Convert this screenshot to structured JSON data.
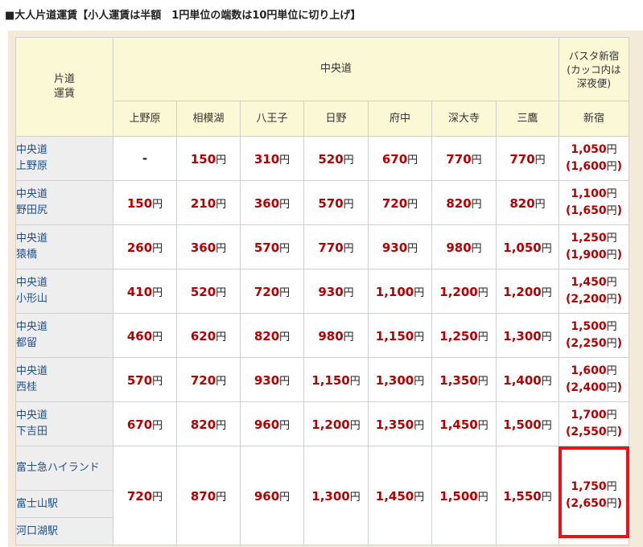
{
  "caption": "■大人片道運賃【小人運賃は半額　1円単位の端数は10円単位に切り上げ】",
  "header": {
    "corner": "片道\n運賃",
    "group": "中央道",
    "right_title": "バスタ新宿\n(カッコ内は\n深夜便)",
    "columns": [
      "上野原",
      "相模湖",
      "八王子",
      "日野",
      "府中",
      "深大寺",
      "三鷹"
    ],
    "right_column": "新宿"
  },
  "yen": "円",
  "rows": [
    {
      "label": "中央道\n上野原",
      "fares": [
        "-",
        "150",
        "310",
        "520",
        "670",
        "770",
        "770"
      ],
      "shinjuku": "1,050",
      "night": "1,600"
    },
    {
      "label": "中央道\n野田尻",
      "fares": [
        "150",
        "210",
        "360",
        "570",
        "720",
        "820",
        "820"
      ],
      "shinjuku": "1,100",
      "night": "1,650"
    },
    {
      "label": "中央道\n猿橋",
      "fares": [
        "260",
        "360",
        "570",
        "770",
        "930",
        "980",
        "1,050"
      ],
      "shinjuku": "1,250",
      "night": "1,900"
    },
    {
      "label": "中央道\n小形山",
      "fares": [
        "410",
        "520",
        "720",
        "930",
        "1,100",
        "1,200",
        "1,200"
      ],
      "shinjuku": "1,450",
      "night": "2,200"
    },
    {
      "label": "中央道\n都留",
      "fares": [
        "460",
        "620",
        "820",
        "980",
        "1,150",
        "1,250",
        "1,300"
      ],
      "shinjuku": "1,500",
      "night": "2,250"
    },
    {
      "label": "中央道\n西桂",
      "fares": [
        "570",
        "720",
        "930",
        "1,150",
        "1,300",
        "1,350",
        "1,400"
      ],
      "shinjuku": "1,600",
      "night": "2,400"
    },
    {
      "label": "中央道\n下吉田",
      "fares": [
        "670",
        "820",
        "960",
        "1,200",
        "1,350",
        "1,450",
        "1,500"
      ],
      "shinjuku": "1,700",
      "night": "2,550"
    }
  ],
  "group_row": {
    "labels": [
      "富士急ハイランド",
      "富士山駅",
      "河口湖駅"
    ],
    "fares": [
      "720",
      "870",
      "960",
      "1,300",
      "1,450",
      "1,500",
      "1,550"
    ],
    "shinjuku": "1,750",
    "night": "2,650"
  },
  "highlight_color": "#e8141b"
}
